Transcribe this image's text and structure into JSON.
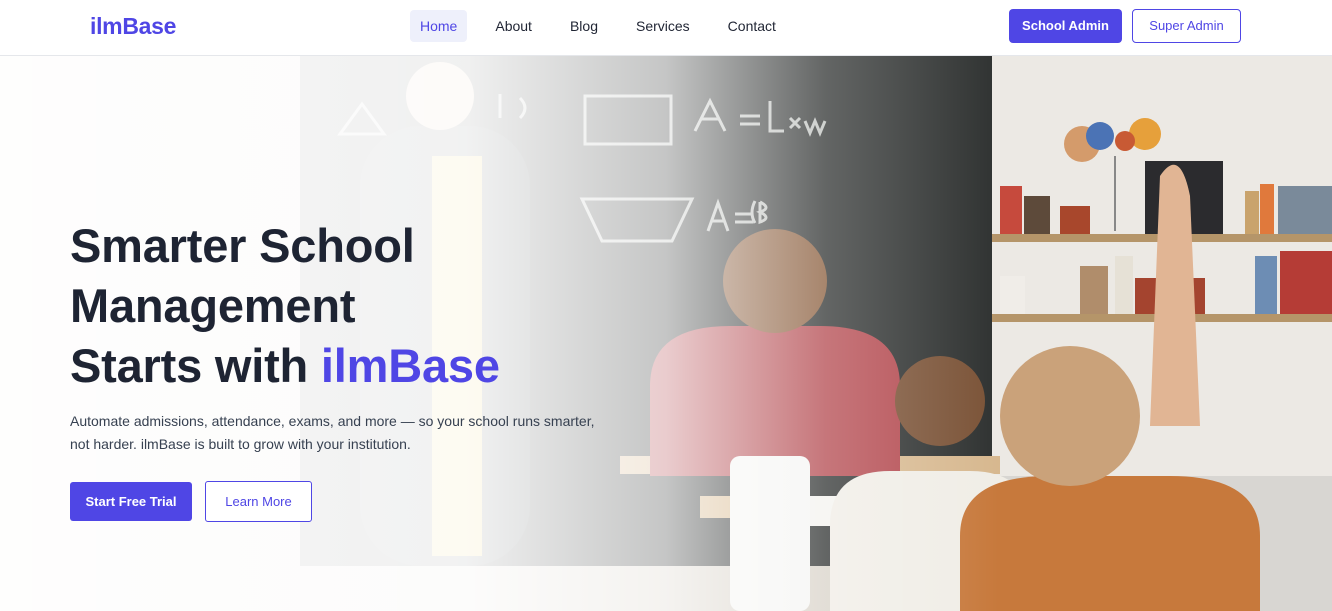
{
  "brand": {
    "name": "ilmBase",
    "accent_color": "#4f46e5"
  },
  "nav": {
    "items": [
      {
        "label": "Home",
        "active": true
      },
      {
        "label": "About",
        "active": false
      },
      {
        "label": "Blog",
        "active": false
      },
      {
        "label": "Services",
        "active": false
      },
      {
        "label": "Contact",
        "active": false
      }
    ],
    "school_admin_label": "School Admin",
    "super_admin_label": "Super Admin"
  },
  "hero": {
    "title_line1": "Smarter School",
    "title_line2": "Management",
    "title_line3_prefix": "Starts with",
    "title_line3_accent": "ilmBase",
    "subtitle_line1": "Automate admissions, attendance, exams, and more — so your school runs smarter,",
    "subtitle_line2": "not harder. ilmBase is built to grow with your institution.",
    "primary_cta": "Start Free Trial",
    "secondary_cta": "Learn More"
  }
}
